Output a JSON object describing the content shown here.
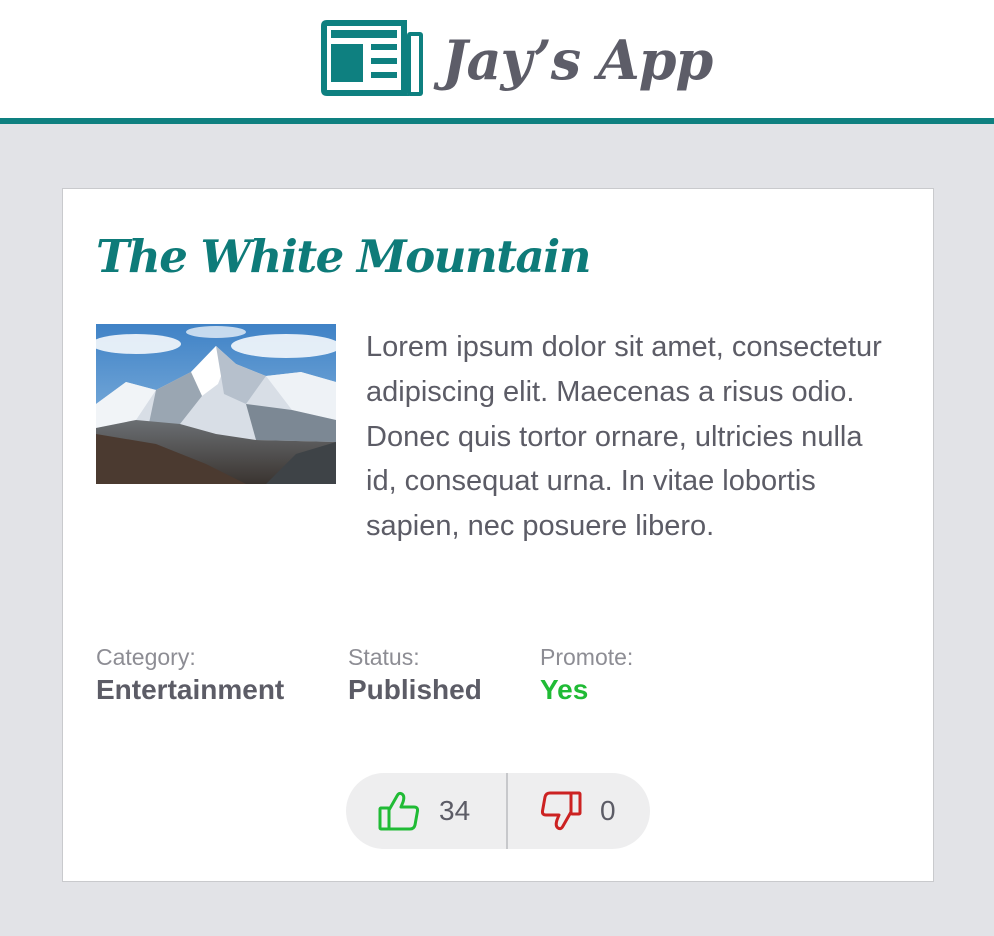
{
  "app": {
    "title": "Jay’s App",
    "logo_icon": "newspaper-icon",
    "brand_color": "#0e8080",
    "title_color": "#5d5d68"
  },
  "article": {
    "title": "The White Mountain",
    "image_subject": "snow-capped mountain",
    "body": "Lorem ipsum dolor sit amet, consectetur adipiscing elit. Maecenas a risus odio. Donec quis tortor ornare, ultricies nulla id, consequat urna. In vitae lobortis sapien, nec posuere libero.",
    "meta": {
      "category_label": "Category:",
      "category_value": "Entertainment",
      "status_label": "Status:",
      "status_value": "Published",
      "promote_label": "Promote:",
      "promote_value": "Yes",
      "promote_color": "#20bb35"
    },
    "votes": {
      "up_icon": "thumbs-up-icon",
      "up_count": "34",
      "up_color": "#20bb35",
      "down_icon": "thumbs-down-icon",
      "down_count": "0",
      "down_color": "#cc2222"
    }
  }
}
